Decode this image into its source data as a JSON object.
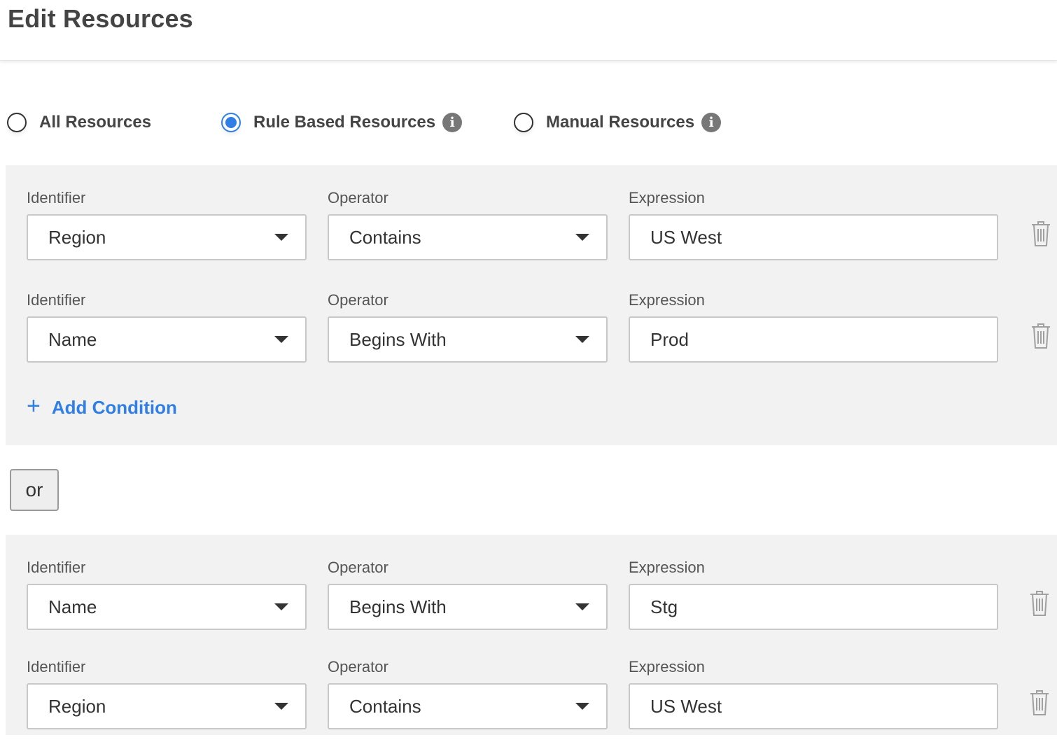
{
  "page": {
    "title": "Edit Resources"
  },
  "resource_mode": {
    "options": [
      {
        "label": "All Resources",
        "selected": false,
        "info": false
      },
      {
        "label": "Rule Based Resources",
        "selected": true,
        "info": true
      },
      {
        "label": "Manual Resources",
        "selected": false,
        "info": true
      }
    ],
    "info_glyph": "i"
  },
  "labels": {
    "identifier": "Identifier",
    "operator": "Operator",
    "expression": "Expression"
  },
  "groups": [
    {
      "conditions": [
        {
          "identifier": "Region",
          "operator": "Contains",
          "expression": "US West"
        },
        {
          "identifier": "Name",
          "operator": "Begins With",
          "expression": "Prod"
        }
      ],
      "add_condition": {
        "icon": "+",
        "label": "Add Condition"
      }
    },
    {
      "conditions": [
        {
          "identifier": "Name",
          "operator": "Begins With",
          "expression": "Stg"
        },
        {
          "identifier": "Region",
          "operator": "Contains",
          "expression": "US West"
        }
      ]
    }
  ],
  "connector": {
    "label": "or"
  },
  "colors": {
    "accent": "#2f7fe6",
    "group_bg": "#f2f2f2",
    "border": "#c8c8c8",
    "text": "#333333"
  },
  "icons": {
    "radio": "radio-circle-icon",
    "info": "info-icon",
    "caret": "caret-down-icon",
    "delete": "trash-icon",
    "add": "plus-icon"
  }
}
